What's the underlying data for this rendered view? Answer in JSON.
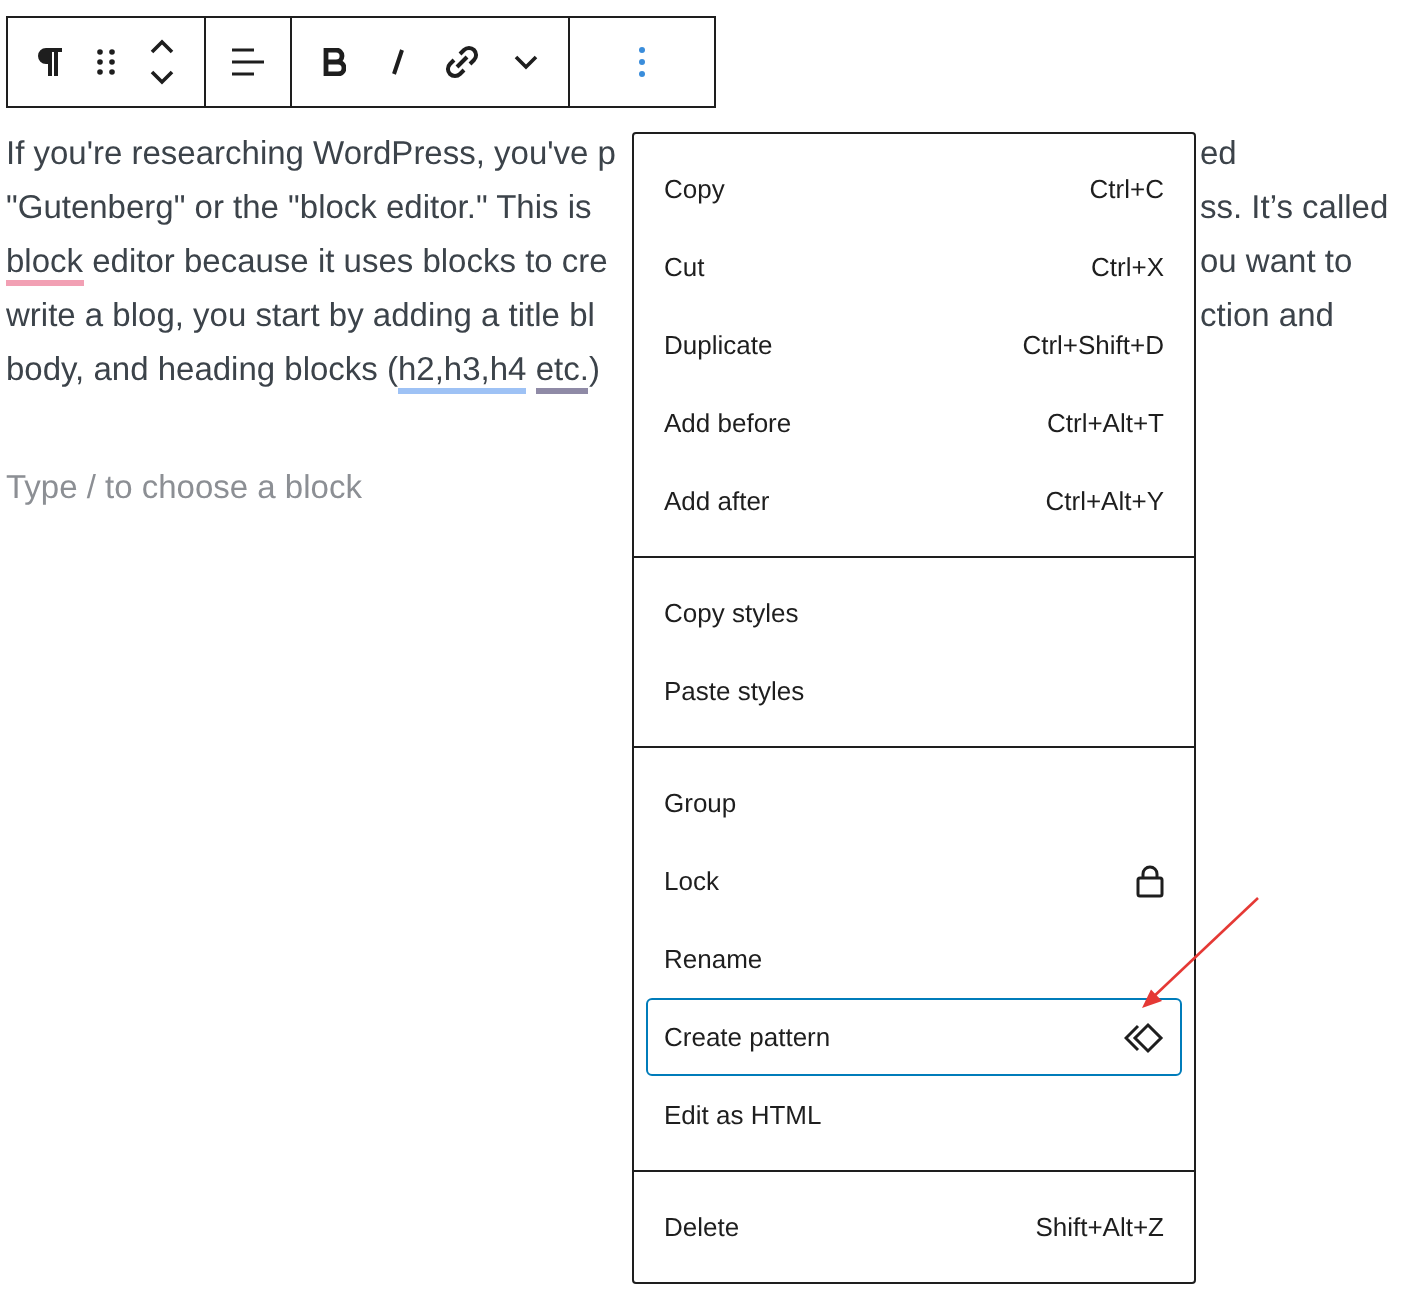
{
  "paragraph": {
    "lines": [
      {
        "left": [
          {
            "text": "If you're researching WordPress, you've p"
          }
        ],
        "right": "ed"
      },
      {
        "left": [
          {
            "text": "\"Gutenberg\" or the \"block editor.\" This is"
          }
        ],
        "right": "ss. It’s called"
      },
      {
        "left": [
          {
            "text": "block",
            "color": "#f2a0b4"
          },
          {
            "text": " editor because it uses blocks to cre"
          }
        ],
        "right": "ou want to"
      },
      {
        "left": [
          {
            "text": "write a blog, you start by adding a title bl"
          }
        ],
        "right": "ction and"
      },
      {
        "left": [
          {
            "text": "body, and heading blocks ("
          },
          {
            "text": "h2,h3,h4",
            "color": "#9ec2f5"
          },
          {
            "text": " etc.",
            "color": "#8f8aa6"
          },
          {
            "text": ")"
          }
        ]
      }
    ]
  },
  "new_block": {
    "placeholder": "Type / to choose a block"
  },
  "menu": {
    "sections": [
      {
        "items": [
          {
            "label": "Copy",
            "kind": "shortcut",
            "shortcut": "Ctrl+C",
            "selected": false
          },
          {
            "label": "Cut",
            "kind": "shortcut",
            "shortcut": "Ctrl+X",
            "selected": false
          },
          {
            "label": "Duplicate",
            "kind": "shortcut",
            "shortcut": "Ctrl+Shift+D",
            "selected": false
          },
          {
            "label": "Add before",
            "kind": "shortcut",
            "shortcut": "Ctrl+Alt+T",
            "selected": false
          },
          {
            "label": "Add after",
            "kind": "shortcut",
            "shortcut": "Ctrl+Alt+Y",
            "selected": false
          }
        ]
      },
      {
        "items": [
          {
            "label": "Copy styles",
            "kind": "plain",
            "selected": false
          },
          {
            "label": "Paste styles",
            "kind": "plain",
            "selected": false
          }
        ]
      },
      {
        "items": [
          {
            "label": "Group",
            "kind": "plain",
            "selected": false
          },
          {
            "label": "Lock",
            "kind": "icon",
            "selected": false
          },
          {
            "label": "Rename",
            "kind": "plain",
            "selected": false
          },
          {
            "label": "Create pattern",
            "kind": "icon",
            "selected": true
          },
          {
            "label": "Edit as HTML",
            "kind": "plain",
            "selected": false
          }
        ]
      },
      {
        "items": [
          {
            "label": "Delete",
            "kind": "shortcut",
            "shortcut": "Shift+Alt+Z",
            "selected": false
          }
        ]
      }
    ]
  }
}
